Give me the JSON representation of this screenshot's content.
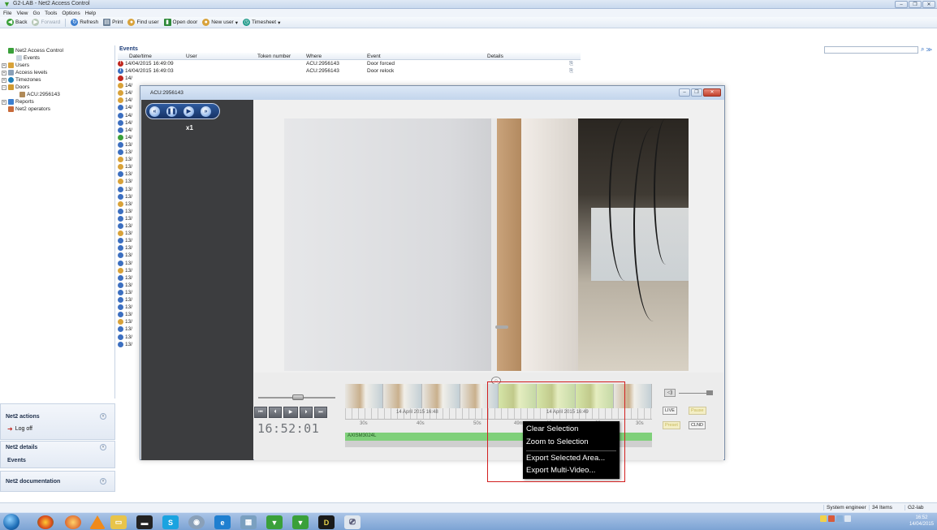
{
  "window": {
    "title": "G2-LAB - Net2 Access Control",
    "controls": [
      "–",
      "❐",
      "✕"
    ]
  },
  "menu": [
    "File",
    "View",
    "Go",
    "Tools",
    "Options",
    "Help"
  ],
  "toolbar": {
    "back": "Back",
    "forward": "Forward",
    "refresh": "Refresh",
    "print": "Print",
    "find_user": "Find user",
    "open_door": "Open door",
    "new_user": "New user",
    "timesheet": "Timesheet"
  },
  "tree": {
    "root": "Net2 Access Control",
    "items": [
      "Events",
      "Users",
      "Access levels",
      "Timezones",
      "Doors",
      "ACU:2956143",
      "Reports",
      "Net2 operators"
    ]
  },
  "left_panels": {
    "actions": {
      "title": "Net2 actions",
      "logoff": "Log off"
    },
    "details": {
      "title": "Net2 details",
      "item": "Events"
    },
    "documentation": {
      "title": "Net2 documentation"
    }
  },
  "grid": {
    "title": "Events",
    "columns": [
      "Date/time",
      "User",
      "Token number",
      "Where",
      "Event",
      "Details"
    ],
    "rows": [
      {
        "datetime": "14/04/2015 16:49:09",
        "user": "",
        "token": "",
        "where": "ACU:2956143",
        "event": "Door forced",
        "details": "",
        "icon": "red"
      },
      {
        "datetime": "14/04/2015 16:49:03",
        "user": "",
        "token": "",
        "where": "ACU:2956143",
        "event": "Door relock",
        "details": "",
        "icon": "blue"
      }
    ],
    "truncated": [
      "14/",
      "14/",
      "14/",
      "14/",
      "14/",
      "14/",
      "14/",
      "14/",
      "14/",
      "13/",
      "13/",
      "13/",
      "13/",
      "13/",
      "13/",
      "13/",
      "13/",
      "13/",
      "13/",
      "13/",
      "13/",
      "13/",
      "13/",
      "13/",
      "13/",
      "13/",
      "13/",
      "13/",
      "13/",
      "13/",
      "13/",
      "13/",
      "13/",
      "13/",
      "13/",
      "13/",
      "13/"
    ]
  },
  "video_window": {
    "title": "ACU:2956143",
    "speed": "x1",
    "clock": "16:52:01",
    "timeline_label_1": "14 April 2015 16:48",
    "timeline_label_2": "14 April 2015 16:49",
    "ticks": [
      "30s",
      "40s",
      "50s",
      "49m",
      "10s",
      "20s",
      "30s"
    ],
    "camera_label": "AXISM3024L",
    "camera_sub": "All Cameras",
    "live_btn": "LIVE",
    "clnd_btn": "CLND",
    "pause_btn": "Pause",
    "preset_btn": "Preset"
  },
  "context_menu": {
    "items": [
      "Clear Selection",
      "Zoom to Selection",
      "Export Selected Area...",
      "Export Multi-Video..."
    ]
  },
  "status": {
    "role": "System engineer",
    "count": "34 Items",
    "site": "G2-lab"
  },
  "clock": {
    "time": "16:52",
    "date": "14/04/2015"
  },
  "colors": {
    "highlight_box": "#d21f1f",
    "timeline_green": "#7fd07a",
    "panel_dark": "#3c3d3f"
  }
}
